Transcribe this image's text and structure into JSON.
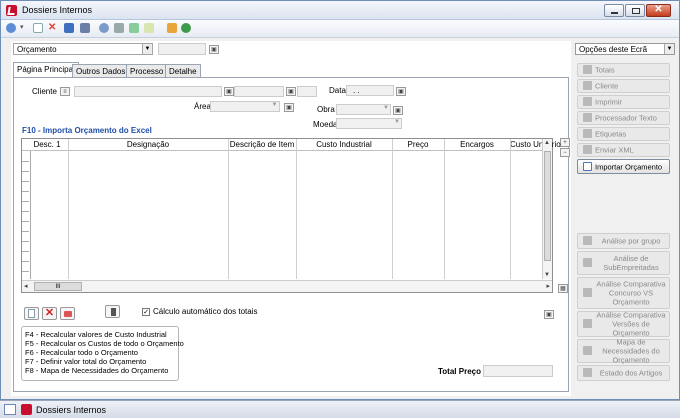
{
  "window": {
    "title": "Dossiers Internos"
  },
  "header": {
    "doc_type": "Orçamento"
  },
  "tabs": [
    "Página Principal",
    "Outros Dados",
    "Processo",
    "Detalhe"
  ],
  "form": {
    "cliente_label": "Cliente",
    "data_label": "Data",
    "data_value": ". .",
    "area_label": "Área",
    "obra_label": "Obra",
    "moeda_label": "Moeda",
    "section_title": "F10 - Importa Orçamento do Excel"
  },
  "grid": {
    "columns": [
      "Desc. 1",
      "Designação",
      "Descrição de Item",
      "Custo Industrial",
      "Preço",
      "Encargos",
      "Custo Unitário"
    ],
    "hscroll_grip": "III"
  },
  "bottom": {
    "auto_calc_label": "Cálculo automático dos totais",
    "auto_calc_checked": true,
    "help_lines": [
      "F4 - Recalcular valores de Custo Industrial",
      "F5 - Recalcular os Custos de todo o Orçamento",
      "F6 - Recalcular todo o Orçamento",
      "F7 - Definir valor total do Orçamento",
      "F8 - Mapa de Necessidades do Orçamento"
    ],
    "total_label": "Total Preço"
  },
  "right_panel": {
    "options_label": "Opções deste Ecrã",
    "top_buttons": [
      {
        "label": "Totais",
        "enabled": false
      },
      {
        "label": "Cliente",
        "enabled": false
      },
      {
        "label": "Imprimir",
        "enabled": false
      },
      {
        "label": "Processador Texto",
        "enabled": false
      },
      {
        "label": "Etiquetas",
        "enabled": false
      },
      {
        "label": "Enviar XML",
        "enabled": false
      },
      {
        "label": "Importar Orçamento",
        "enabled": true
      }
    ],
    "bottom_buttons": [
      {
        "label": "Análise por grupo"
      },
      {
        "label": "Análise de SubEmpreitadas"
      },
      {
        "label": "Análise Comparativa Concurso VS Orçamento"
      },
      {
        "label": "Análise Comparativa Versões de Orçamento"
      },
      {
        "label": "Mapa de Necessidades do Orçamento"
      },
      {
        "label": "Estado dos Artigos"
      }
    ]
  },
  "taskbar": {
    "item_label": "Dossiers Internos"
  },
  "colors": {
    "section_title": "#1f4fa8",
    "app_icon": "#c8102e"
  }
}
